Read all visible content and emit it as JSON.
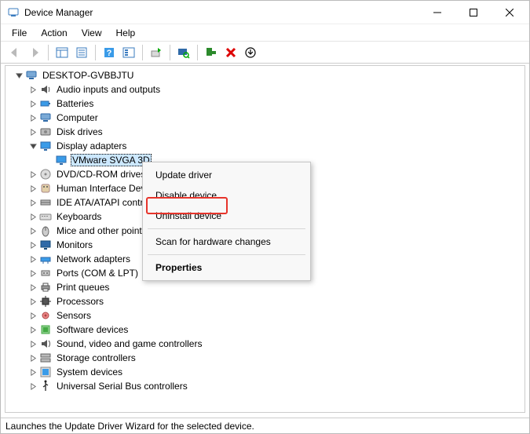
{
  "window": {
    "title": "Device Manager"
  },
  "menus": {
    "file": "File",
    "action": "Action",
    "view": "View",
    "help": "Help"
  },
  "tree": {
    "root": "DESKTOP-GVBBJTU",
    "items": [
      {
        "icon": "audio",
        "label": "Audio inputs and outputs"
      },
      {
        "icon": "battery",
        "label": "Batteries"
      },
      {
        "icon": "computer",
        "label": "Computer"
      },
      {
        "icon": "disk",
        "label": "Disk drives"
      },
      {
        "icon": "display",
        "label": "Display adapters",
        "expanded": true,
        "children": [
          {
            "icon": "display",
            "label": "VMware SVGA 3D",
            "selected": true
          }
        ]
      },
      {
        "icon": "cdrom",
        "label": "DVD/CD-ROM drives"
      },
      {
        "icon": "hid",
        "label": "Human Interface Devices"
      },
      {
        "icon": "ide",
        "label": "IDE ATA/ATAPI controllers"
      },
      {
        "icon": "keyboard",
        "label": "Keyboards"
      },
      {
        "icon": "mouse",
        "label": "Mice and other pointing devices"
      },
      {
        "icon": "monitor",
        "label": "Monitors"
      },
      {
        "icon": "network",
        "label": "Network adapters"
      },
      {
        "icon": "ports",
        "label": "Ports (COM & LPT)"
      },
      {
        "icon": "printer",
        "label": "Print queues"
      },
      {
        "icon": "cpu",
        "label": "Processors"
      },
      {
        "icon": "sensor",
        "label": "Sensors"
      },
      {
        "icon": "software",
        "label": "Software devices"
      },
      {
        "icon": "sound",
        "label": "Sound, video and game controllers"
      },
      {
        "icon": "storage",
        "label": "Storage controllers"
      },
      {
        "icon": "system",
        "label": "System devices"
      },
      {
        "icon": "usb",
        "label": "Universal Serial Bus controllers"
      }
    ]
  },
  "context_menu": {
    "update": "Update driver",
    "disable": "Disable device",
    "uninstall": "Uninstall device",
    "scan": "Scan for hardware changes",
    "properties": "Properties"
  },
  "status": "Launches the Update Driver Wizard for the selected device."
}
